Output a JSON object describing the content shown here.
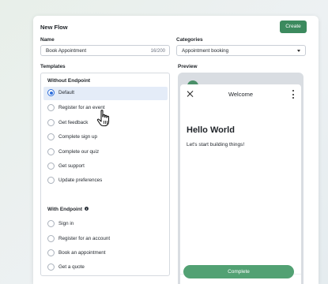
{
  "dialog": {
    "title": "New Flow",
    "create_label": "Create"
  },
  "name_field": {
    "label": "Name",
    "value": "Book Appointment",
    "counter": "16/200"
  },
  "categories_field": {
    "label": "Categories",
    "value": "Appointment booking"
  },
  "templates": {
    "label": "Templates",
    "without_endpoint": {
      "heading": "Without Endpoint",
      "items": [
        {
          "label": "Default",
          "selected": true
        },
        {
          "label": "Register for an event",
          "selected": false
        },
        {
          "label": "Get feedback",
          "selected": false
        },
        {
          "label": "Complete sign up",
          "selected": false
        },
        {
          "label": "Complete our quiz",
          "selected": false
        },
        {
          "label": "Get support",
          "selected": false
        },
        {
          "label": "Update preferences",
          "selected": false
        }
      ]
    },
    "with_endpoint": {
      "heading": "With Endpoint",
      "items": [
        {
          "label": "Sign in",
          "selected": false
        },
        {
          "label": "Register for an account",
          "selected": false
        },
        {
          "label": "Book an appointment",
          "selected": false
        },
        {
          "label": "Get a quote",
          "selected": false
        }
      ]
    }
  },
  "preview": {
    "label": "Preview",
    "screen_title": "Welcome",
    "heading": "Hello World",
    "body": "Let's start building things!",
    "button_label": "Complete"
  },
  "colors": {
    "primary": "#3c8a5e",
    "selection": "#e4ecf8",
    "radio_selected": "#2f6fdb"
  },
  "icons": [
    "info-icon",
    "close-icon",
    "more-vertical-icon",
    "chevron-down-icon",
    "hand-pointer-cursor"
  ]
}
